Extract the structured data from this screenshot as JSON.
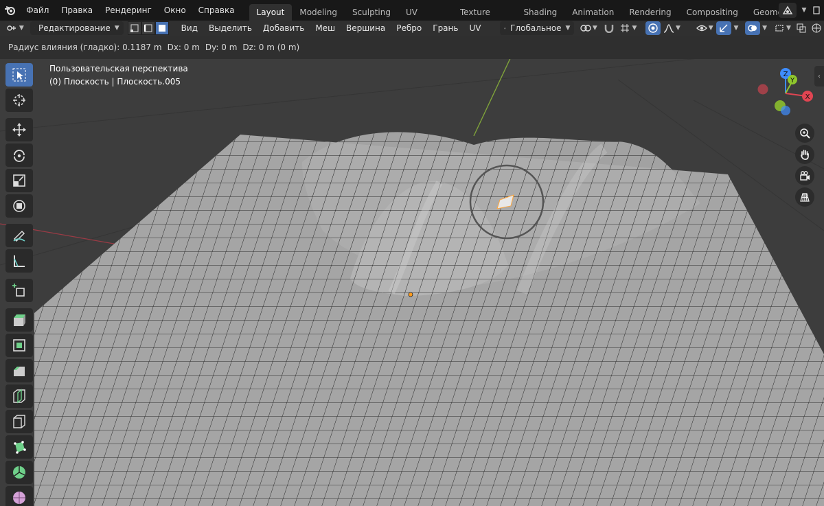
{
  "menu": {
    "file": "Файл",
    "edit": "Правка",
    "render": "Рендеринг",
    "window": "Окно",
    "help": "Справка"
  },
  "workspaces": [
    {
      "label": "Layout",
      "active": true
    },
    {
      "label": "Modeling",
      "active": false
    },
    {
      "label": "Sculpting",
      "active": false
    },
    {
      "label": "UV Editing",
      "active": false
    },
    {
      "label": "Texture Paint",
      "active": false
    },
    {
      "label": "Shading",
      "active": false
    },
    {
      "label": "Animation",
      "active": false
    },
    {
      "label": "Rendering",
      "active": false
    },
    {
      "label": "Compositing",
      "active": false
    },
    {
      "label": "Geometry Nodes",
      "active": false
    }
  ],
  "header": {
    "mode": "Редактирование",
    "view": "Вид",
    "select": "Выделить",
    "add": "Добавить",
    "mesh": "Меш",
    "vertex": "Вершина",
    "edge": "Ребро",
    "face": "Грань",
    "uv": "UV",
    "orientation": "Глобальное"
  },
  "info": {
    "radius": "Радиус влияния (гладко): 0.1187 m",
    "dx": "Dx: 0 m",
    "dy": "Dy: 0 m",
    "dz": "Dz: 0 m (0 m)"
  },
  "viewport": {
    "perspective": "Пользовательская перспектива",
    "object": "(0) Плоскость | Плоскость.005"
  },
  "gizmo": {
    "z": "Z",
    "y": "Y",
    "x": "X"
  },
  "colors": {
    "accent": "#4772b3",
    "mesh_fill": "#a5a5a5",
    "wire": "#1a1a1a",
    "axis_x": "#e04552",
    "axis_y": "#8fc62d",
    "axis_z": "#3e8dff"
  },
  "icons": {
    "toolbar": [
      "select-box-icon",
      "cursor-icon",
      "move-icon",
      "rotate-icon",
      "scale-icon",
      "transform-icon",
      "annotate-icon",
      "measure-icon",
      "add-cube-icon",
      "extrude-icon",
      "inset-icon",
      "bevel-icon",
      "loop-cut-icon",
      "knife-icon",
      "poly-build-icon",
      "spin-icon",
      "smooth-icon"
    ],
    "nav": [
      "zoom-icon",
      "hand-icon",
      "camera-icon",
      "grid-icon"
    ]
  }
}
